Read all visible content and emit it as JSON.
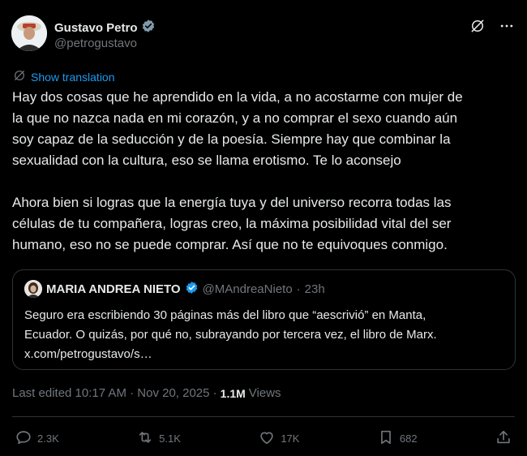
{
  "author": {
    "name": "Gustavo Petro",
    "handle": "@petrogustavo",
    "verified_color": "#829aab"
  },
  "translate_label": "Show translation",
  "body": {
    "paragraph1": "Hay dos cosas que he aprendido en la vida, a no acostarme con mujer de\nla que no nazca nada en mi corazón, y a no comprar el sexo cuando aún\nsoy capaz de la seducción y de la poesía.  Siempre hay que combinar la\nsexualidad con la cultura, eso se llama erotismo. Te lo aconsejo",
    "paragraph2": "Ahora bien si logras que la energía tuya y del universo recorra todas las\ncélulas de tu compañera, logras creo, la máxima posibilidad vital del ser\nhumano, eso no se puede comprar. Así que no te equivoques conmigo."
  },
  "quote": {
    "name": "MARIA ANDREA NIETO",
    "handle": "@MAndreaNieto",
    "separator": "·",
    "time": "23h",
    "verified_color": "#1d9bf0",
    "lines": [
      "Seguro era escribiendo 30 páginas más del libro que “aescrivió” en Manta,",
      "Ecuador. O quizás, por qué no, subrayando por tercera vez, el libro de Marx.",
      "x.com/petrogustavo/s…"
    ]
  },
  "meta": {
    "edited": "Last edited 10:17 AM · Nov 20, 2025 ·",
    "views_count": "1.1M",
    "views_label": "Views"
  },
  "actions": {
    "replies": "2.3K",
    "reposts": "5.1K",
    "likes": "17K",
    "bookmarks": "682"
  },
  "colors": {
    "background": "#000000",
    "text": "#e7e9ea",
    "secondary": "#71767b",
    "accent": "#1d9bf0",
    "border": "#2f3336"
  },
  "icons": {
    "translate": "globe-icon",
    "grok": "grok-icon",
    "more": "more-icon",
    "reply": "reply-icon",
    "repost": "repost-icon",
    "like": "heart-icon",
    "bookmark": "bookmark-icon",
    "share": "share-icon"
  }
}
